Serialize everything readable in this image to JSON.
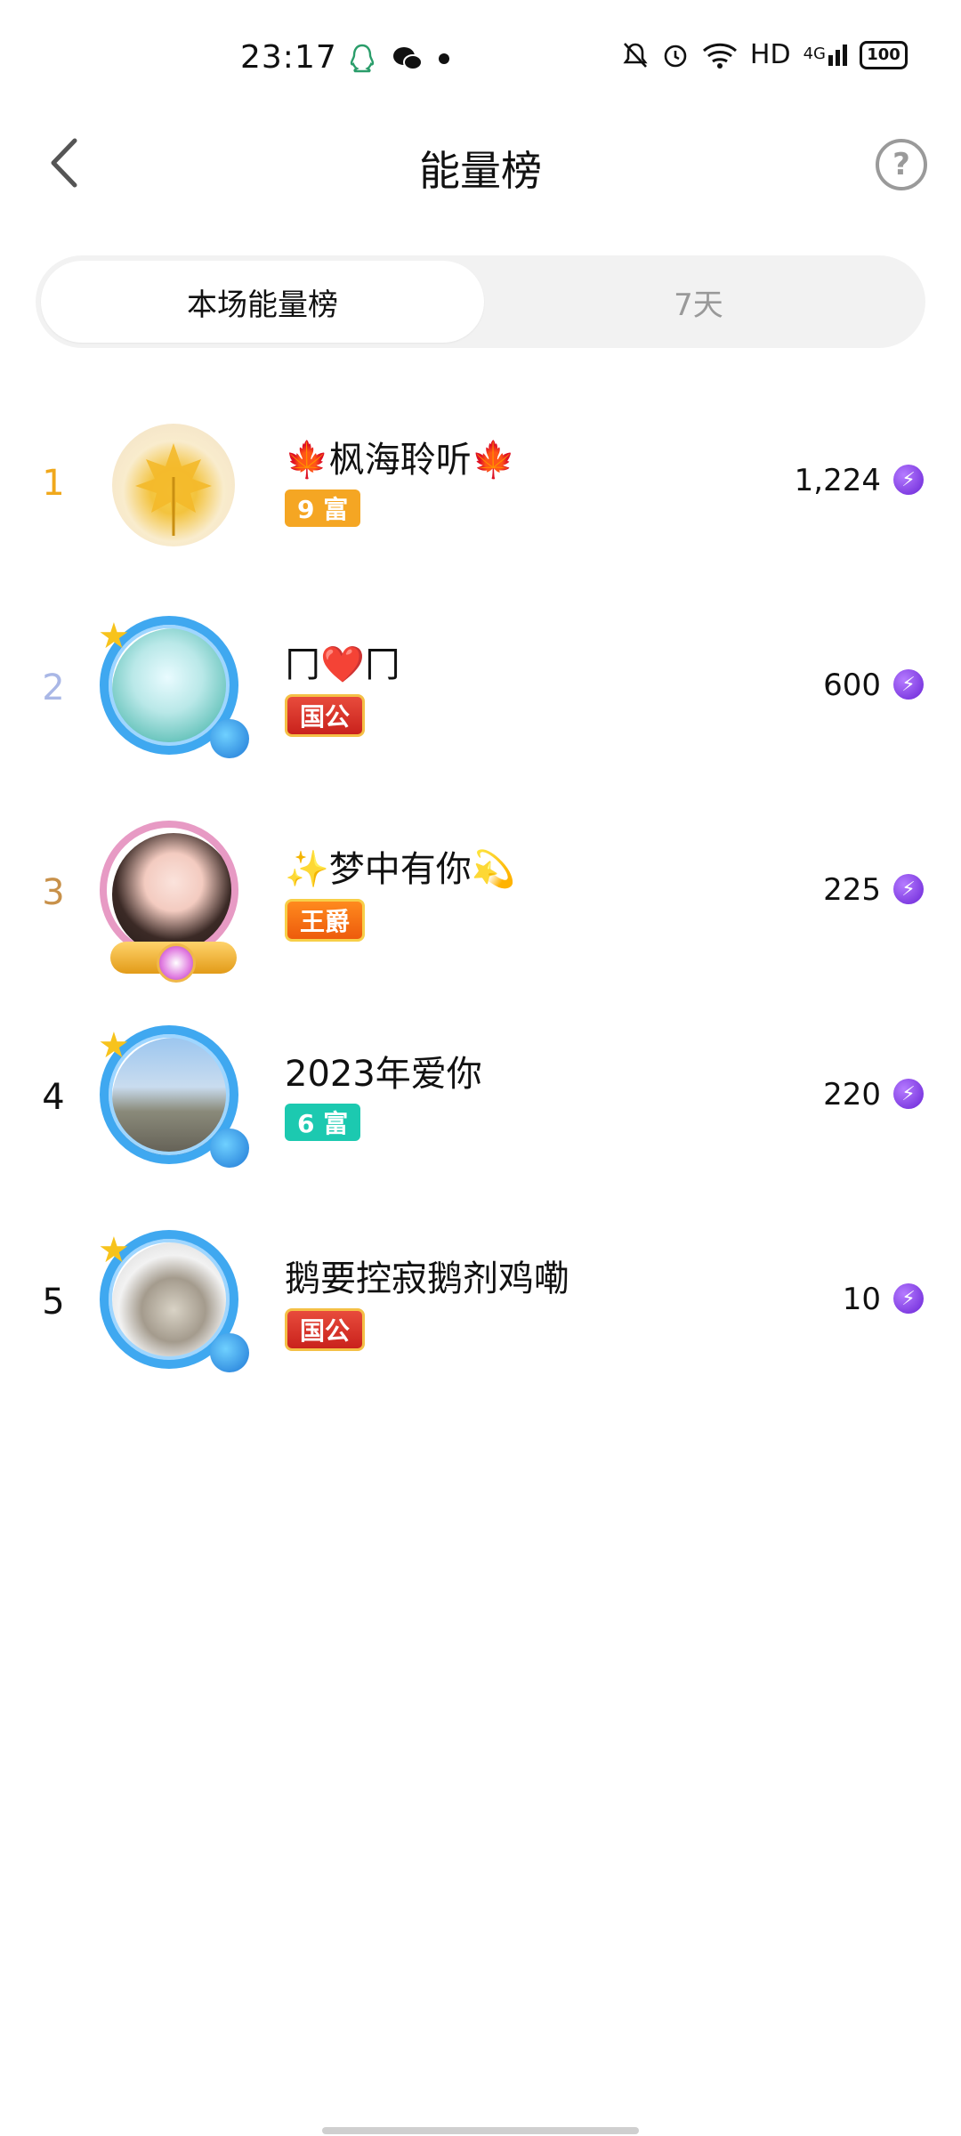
{
  "status_bar": {
    "time": "23:17",
    "network_label": "HD",
    "signal_label": "4G",
    "battery": "100",
    "icons": [
      "qq-icon",
      "wechat-icon",
      "dot-icon",
      "mute-bell-icon",
      "alarm-icon",
      "wifi-icon",
      "signal-icon",
      "battery-icon"
    ]
  },
  "header": {
    "title": "能量榜",
    "help_symbol": "?"
  },
  "tabs": [
    {
      "label": "本场能量榜",
      "active": true
    },
    {
      "label": "7天",
      "active": false
    }
  ],
  "leaderboard": [
    {
      "rank": "1",
      "rank_color": "#f0a81c",
      "name": "🍁枫海聆听🍁",
      "badge": "9 富",
      "badge_style": "gold",
      "score": "1,224",
      "frame": "none"
    },
    {
      "rank": "2",
      "rank_color": "#a9b7e6",
      "name": "冂❤️冂",
      "badge": "国公",
      "badge_style": "red",
      "score": "600",
      "frame": "blue"
    },
    {
      "rank": "3",
      "rank_color": "#c8914a",
      "name": "✨梦中有你💫",
      "badge": "王爵",
      "badge_style": "orange",
      "score": "225",
      "frame": "pink"
    },
    {
      "rank": "4",
      "rank_color": "#111111",
      "name": "2023年爱你",
      "badge": "6 富",
      "badge_style": "teal",
      "score": "220",
      "frame": "blue"
    },
    {
      "rank": "5",
      "rank_color": "#111111",
      "name": "鹅要控寂鹅剂鸡嘞",
      "badge": "国公",
      "badge_style": "red",
      "score": "10",
      "frame": "blue"
    }
  ],
  "colors": {
    "accent_bolt": "#7a3be0",
    "tab_bg": "#f2f2f2"
  }
}
